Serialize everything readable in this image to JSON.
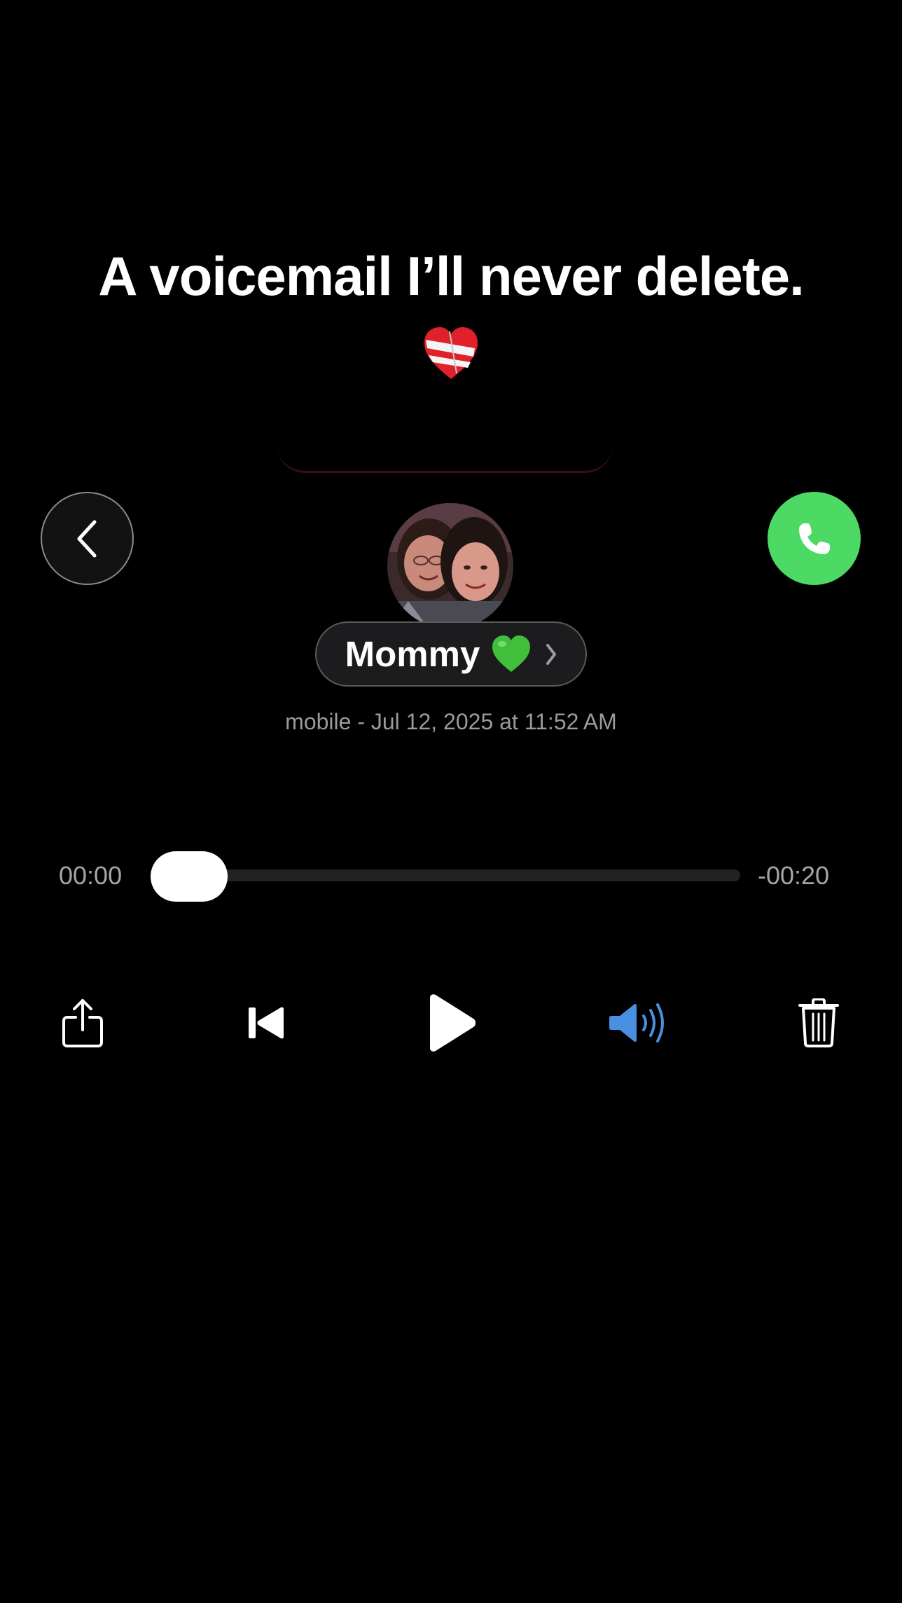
{
  "caption": {
    "text": "A voicemail I’ll never delete.",
    "emoji_icon": "mending-heart-icon"
  },
  "header": {
    "back_icon": "chevron-left-icon",
    "call_icon": "phone-icon",
    "call_color": "#4cd964"
  },
  "contact": {
    "avatar": "contact-photo",
    "name": "Mommy",
    "name_emoji_icon": "green-heart-icon",
    "disclosure_icon": "chevron-right-icon"
  },
  "voicemail": {
    "meta": "mobile - Jul 12, 2025 at 11:52 AM",
    "elapsed": "00:00",
    "remaining": "-00:20",
    "progress_fraction": 0
  },
  "controls": {
    "share_icon": "share-icon",
    "skip_back_icon": "skip-back-icon",
    "play_icon": "play-icon",
    "speaker_icon": "speaker-icon",
    "speaker_color": "#4a90e2",
    "delete_icon": "trash-icon"
  }
}
